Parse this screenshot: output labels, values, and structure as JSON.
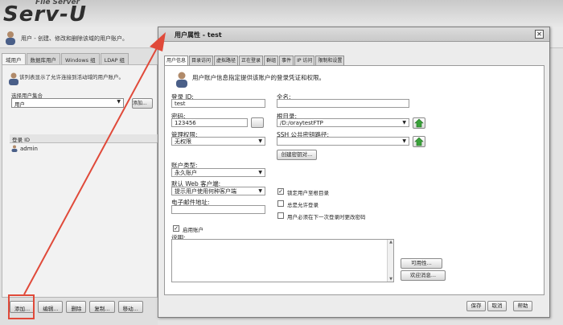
{
  "app": {
    "brand_small": "File Server",
    "brand_big": "Serv-U",
    "description": "用户 - 创建、修改和删除该域的用户账户。"
  },
  "bg_tabs": [
    {
      "label": "域用户"
    },
    {
      "label": "数据库用户"
    },
    {
      "label": "Windows 组"
    },
    {
      "label": "LDAP 组"
    }
  ],
  "bg_panel": {
    "info": "该列表显示了允许连接到活动域的用户账户。",
    "group_label": "选择用户集合",
    "group_value": "用户",
    "group_button": "添加...",
    "list_header": "登录 ID",
    "users": [
      "admin"
    ]
  },
  "bg_buttons": [
    {
      "label": "添加..."
    },
    {
      "label": "编辑..."
    },
    {
      "label": "删除"
    },
    {
      "label": "复制..."
    },
    {
      "label": "移动..."
    }
  ],
  "dialog": {
    "title": "用户属性 - test",
    "close_glyph": "✕",
    "tabs": [
      {
        "label": "用户信息",
        "active": true
      },
      {
        "label": "目录访问"
      },
      {
        "label": "虚拟路径"
      },
      {
        "label": "正在登录"
      },
      {
        "label": "群组"
      },
      {
        "label": "事件"
      },
      {
        "label": "IP 访问"
      },
      {
        "label": "限制和设置"
      }
    ],
    "intro": "用户账户信息指定提供该账户的登录凭证和权限。",
    "login_id_label": "登录 ID:",
    "login_id_value": "test",
    "fullname_label": "全名:",
    "fullname_value": "",
    "password_label": "密码:",
    "password_value": "123456",
    "root_dir_label": "根目录:",
    "root_dir_value": "/D:/oraytestFTP",
    "admin_label": "管理权限:",
    "admin_value": "无权限",
    "ssh_label": "SSH 公共密钥路径:",
    "ssh_value": "",
    "create_key_button": "创建密钥对...",
    "account_type_label": "账户类型:",
    "account_type_value": "永久账户",
    "web_client_label": "默认 Web 客户端:",
    "web_client_value": "提示用户使用何种客户端",
    "email_label": "电子邮件地址:",
    "email_value": "",
    "lock_home_label": "锁定用户至根目录",
    "lock_home_checked": true,
    "always_allow_label": "总是允许登录",
    "always_allow_checked": false,
    "change_pw_label": "用户必须在下一次登录时更改密码",
    "change_pw_checked": false,
    "enable_label": "启用账户",
    "enable_checked": true,
    "desc_label": "说明:",
    "desc_value": "",
    "availability_button": "可用性...",
    "welcome_button": "欢迎消息...",
    "save_button": "保存",
    "cancel_button": "取消",
    "help_button": "帮助"
  },
  "colors": {
    "annotation_red": "#e04a3a",
    "browse_green": "#3aa23a"
  }
}
